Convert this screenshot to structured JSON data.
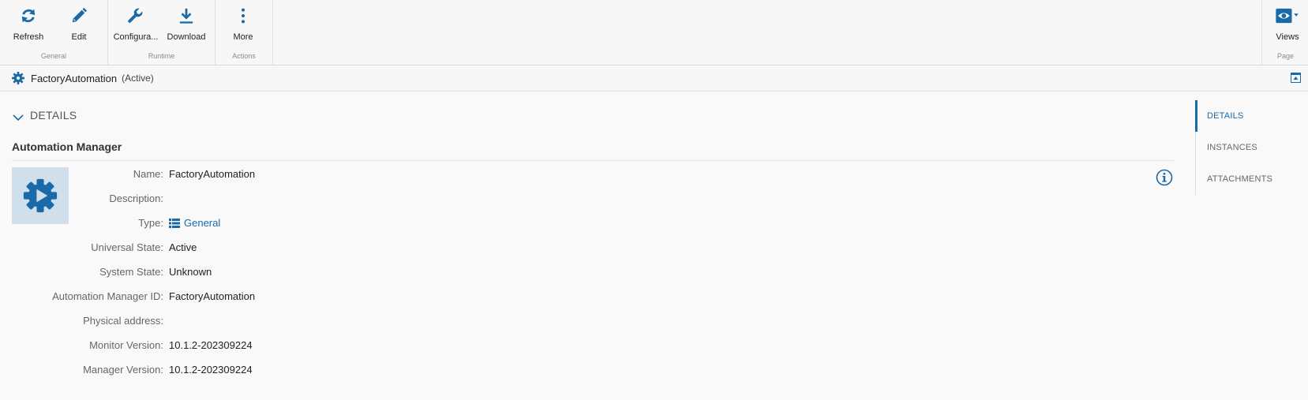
{
  "ribbon": {
    "groups": [
      {
        "label": "General",
        "buttons": [
          {
            "label": "Refresh",
            "icon": "refresh-icon"
          },
          {
            "label": "Edit",
            "icon": "pencil-icon"
          }
        ]
      },
      {
        "label": "Runtime",
        "buttons": [
          {
            "label": "Configura...",
            "icon": "wrench-icon"
          },
          {
            "label": "Download",
            "icon": "download-icon"
          }
        ]
      },
      {
        "label": "Actions",
        "buttons": [
          {
            "label": "More",
            "icon": "more-vertical-icon"
          }
        ]
      },
      {
        "label": "Page",
        "buttons": [
          {
            "label": "Views",
            "icon": "eye-icon"
          }
        ]
      }
    ]
  },
  "titlebar": {
    "name": "FactoryAutomation",
    "state": "(Active)"
  },
  "section": {
    "title": "DETAILS"
  },
  "card": {
    "title": "Automation Manager",
    "properties": [
      {
        "label": "Name:",
        "value": "FactoryAutomation"
      },
      {
        "label": "Description:",
        "value": ""
      },
      {
        "label": "Type:",
        "value": "General"
      },
      {
        "label": "Universal State:",
        "value": "Active"
      },
      {
        "label": "System State:",
        "value": "Unknown"
      },
      {
        "label": "Automation Manager ID:",
        "value": "FactoryAutomation"
      },
      {
        "label": "Physical address:",
        "value": ""
      },
      {
        "label": "Monitor Version:",
        "value": "10.1.2-202309224"
      },
      {
        "label": "Manager Version:",
        "value": "10.1.2-202309224"
      }
    ]
  },
  "rightnav": {
    "items": [
      "DETAILS",
      "INSTANCES",
      "ATTACHMENTS"
    ],
    "active": "DETAILS"
  },
  "colors": {
    "accent": "#1a6aa8",
    "iconbg": "#cfe0ec"
  }
}
